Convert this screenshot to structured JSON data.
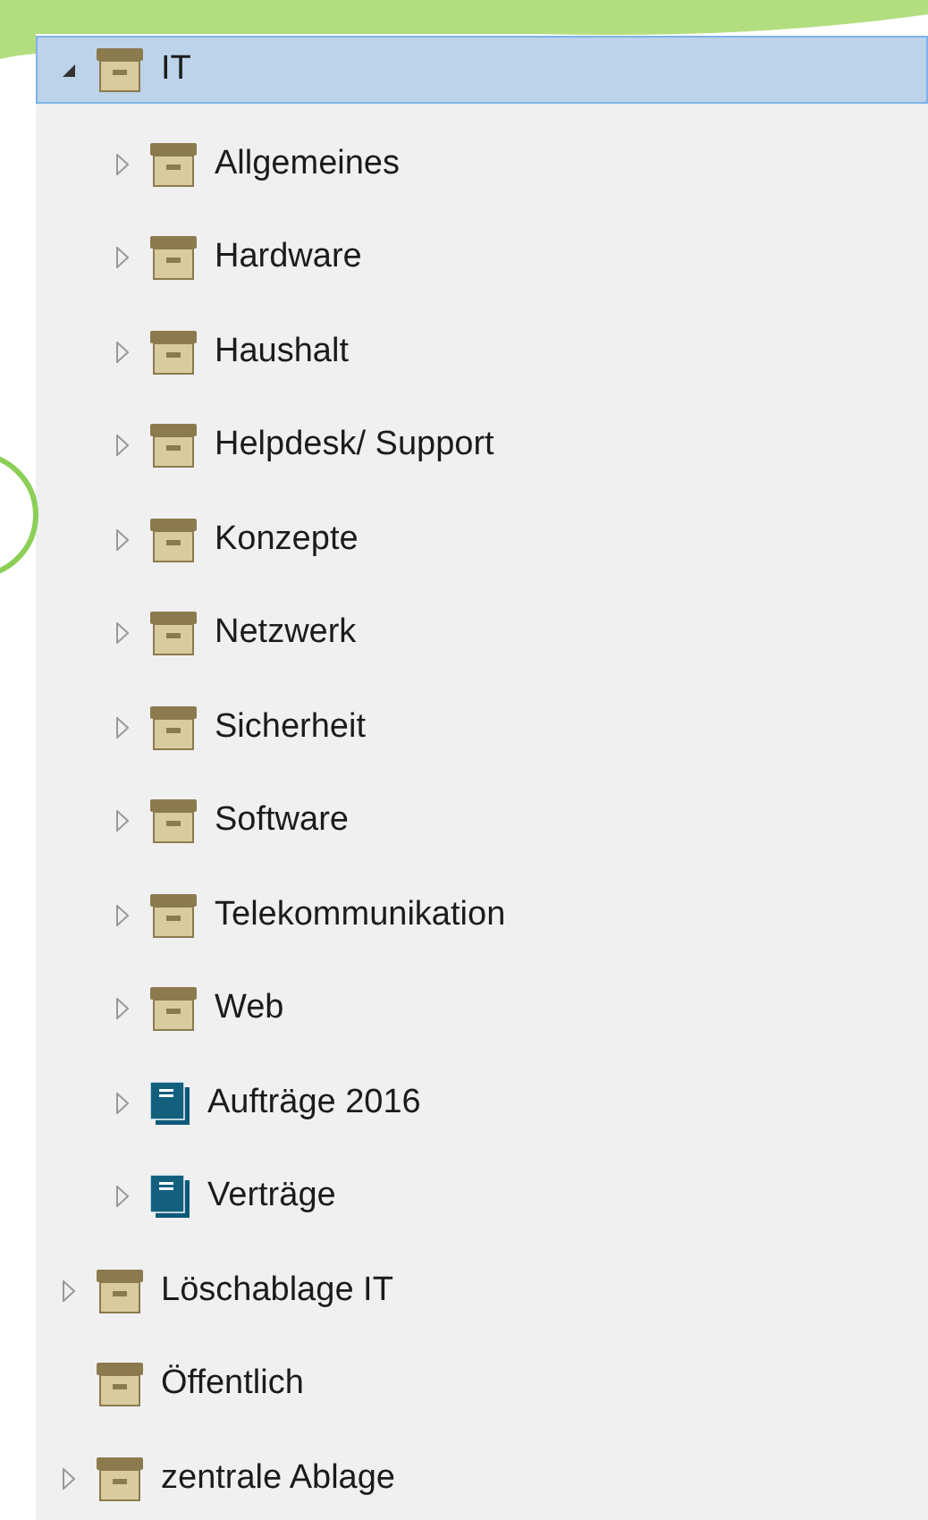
{
  "tree": [
    {
      "label": "IT",
      "kind": "archive",
      "selected": true,
      "expandable": true,
      "expanded": true,
      "children": [
        {
          "label": "Allgemeines",
          "kind": "archive",
          "selected": false,
          "expandable": true,
          "expanded": false
        },
        {
          "label": "Hardware",
          "kind": "archive",
          "selected": false,
          "expandable": true,
          "expanded": false
        },
        {
          "label": "Haushalt",
          "kind": "archive",
          "selected": false,
          "expandable": true,
          "expanded": false
        },
        {
          "label": "Helpdesk/ Support",
          "kind": "archive",
          "selected": false,
          "expandable": true,
          "expanded": false
        },
        {
          "label": "Konzepte",
          "kind": "archive",
          "selected": false,
          "expandable": true,
          "expanded": false
        },
        {
          "label": "Netzwerk",
          "kind": "archive",
          "selected": false,
          "expandable": true,
          "expanded": false
        },
        {
          "label": "Sicherheit",
          "kind": "archive",
          "selected": false,
          "expandable": true,
          "expanded": false
        },
        {
          "label": "Software",
          "kind": "archive",
          "selected": false,
          "expandable": true,
          "expanded": false
        },
        {
          "label": "Telekommunikation",
          "kind": "archive",
          "selected": false,
          "expandable": true,
          "expanded": false
        },
        {
          "label": "Web",
          "kind": "archive",
          "selected": false,
          "expandable": true,
          "expanded": false
        },
        {
          "label": "Aufträge 2016",
          "kind": "book",
          "selected": false,
          "expandable": true,
          "expanded": false
        },
        {
          "label": "Verträge",
          "kind": "book",
          "selected": false,
          "expandable": true,
          "expanded": false
        }
      ]
    },
    {
      "label": "Löschablage IT",
      "kind": "archive",
      "selected": false,
      "expandable": true,
      "expanded": false
    },
    {
      "label": "Öffentlich",
      "kind": "archive",
      "selected": false,
      "expandable": false
    },
    {
      "label": "zentrale Ablage",
      "kind": "archive",
      "selected": false,
      "expandable": true,
      "expanded": false
    }
  ]
}
